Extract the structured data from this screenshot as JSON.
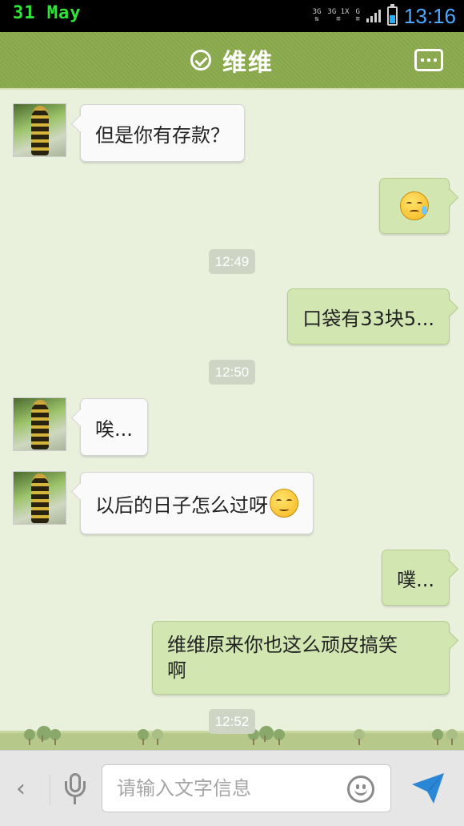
{
  "status_bar": {
    "date": "31 May",
    "network_labels": [
      "3G",
      "3G 1X",
      "G"
    ],
    "time": "13:16",
    "battery_level": 0.5,
    "colors": {
      "date": "#2fe33a",
      "time": "#49a9ff"
    }
  },
  "title_bar": {
    "title": "维维",
    "verified_icon": "check-circle-icon",
    "menu_icon": "more-icon",
    "color": "#8fae53"
  },
  "chat": {
    "incoming_1": {
      "text": "但是你有存款？"
    },
    "outgoing_1": {
      "emoji": "sweat-emoji"
    },
    "time_1": "12:49",
    "outgoing_2": {
      "text": "口袋有33块5..."
    },
    "time_2": "12:50",
    "incoming_2": {
      "text": "唉..."
    },
    "incoming_3": {
      "text": "以后的日子怎么过呀",
      "emoji": "sad-emoji"
    },
    "outgoing_3": {
      "text": "噗..."
    },
    "outgoing_4": {
      "text": "维维原来你也这么顽皮搞笑啊"
    },
    "time_3": "12:52"
  },
  "input_bar": {
    "placeholder": "请输入文字信息",
    "value": "",
    "icons": [
      "chevron-left-icon",
      "microphone-icon",
      "smiley-icon",
      "send-icon"
    ]
  }
}
